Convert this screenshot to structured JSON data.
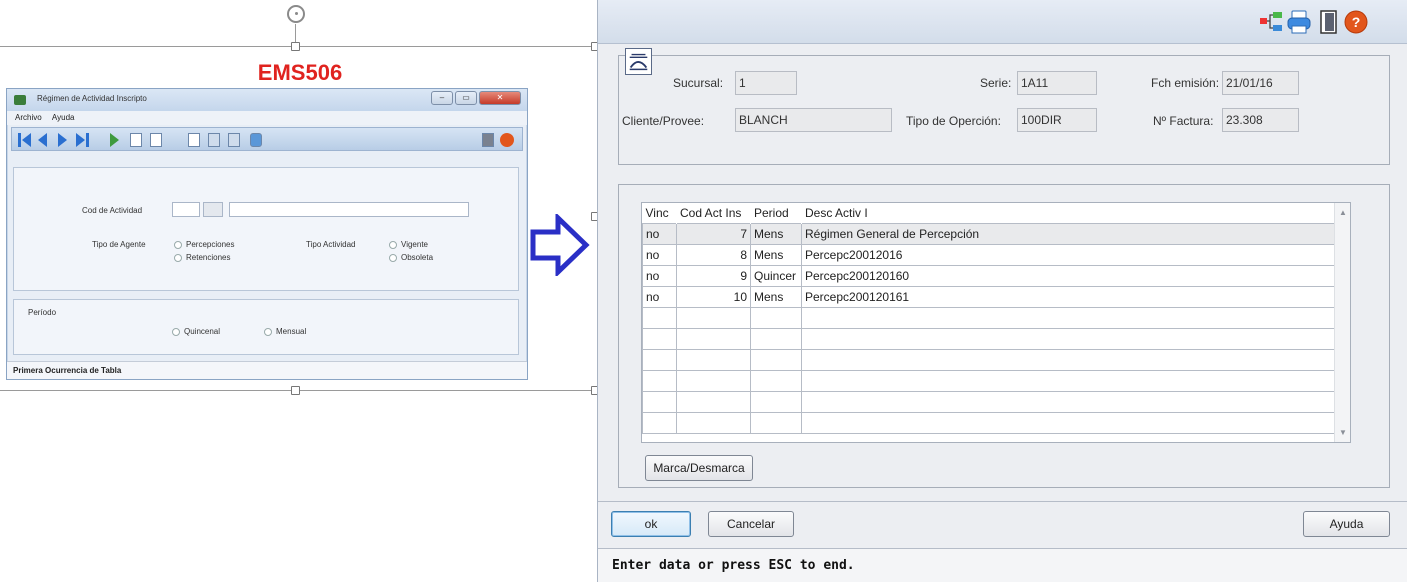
{
  "left_preview": {
    "label": "EMS506",
    "window_title": "Régimen de Actividad Inscripto",
    "menu": [
      "Archivo",
      "Ayuda"
    ],
    "fields": {
      "cod_actividad_label": "Cod de Actividad",
      "tipo_agente_label": "Tipo de Agente",
      "percepciones": "Percepciones",
      "retenciones": "Retenciones",
      "tipo_actividad_label": "Tipo Actividad",
      "vigente": "Vigente",
      "obsoleta": "Obsoleta",
      "periodo_label": "Período",
      "quincenal": "Quincenal",
      "mensual": "Mensual"
    },
    "status": "Primera Ocurrencia de Tabla"
  },
  "dialog": {
    "header_icons": [
      "tree-icon",
      "printer-icon",
      "door-exit-icon",
      "help-icon"
    ],
    "sucursal_label": "Sucursal:",
    "sucursal_value": "1",
    "serie_label": "Serie:",
    "serie_value": "1A11",
    "fch_emision_label": "Fch emisión:",
    "fch_emision_value": "21/01/16",
    "cliente_label": "Cliente/Provee:",
    "cliente_value": "BLANCH",
    "tipo_operacion_label": "Tipo de Operción:",
    "tipo_operacion_value": "100DIR",
    "nro_factura_label": "Nº Factura:",
    "nro_factura_value": "23.308",
    "grid": {
      "columns": [
        "Vinc",
        "Cod Act Ins",
        "Period",
        "Desc Activ I"
      ],
      "rows": [
        [
          "no",
          "7",
          "Mens",
          "Régimen General de Percepción"
        ],
        [
          "no",
          "8",
          "Mens",
          "Percepc20012016"
        ],
        [
          "no",
          "9",
          "Quincer",
          "Percepc200120160"
        ],
        [
          "no",
          "10",
          "Mens",
          "Percepc200120161"
        ]
      ]
    },
    "marca_button": "Marca/Desmarca",
    "ok_button": "ok",
    "cancel_button": "Cancelar",
    "help_button": "Ayuda",
    "status": "Enter data or press ESC to end."
  }
}
